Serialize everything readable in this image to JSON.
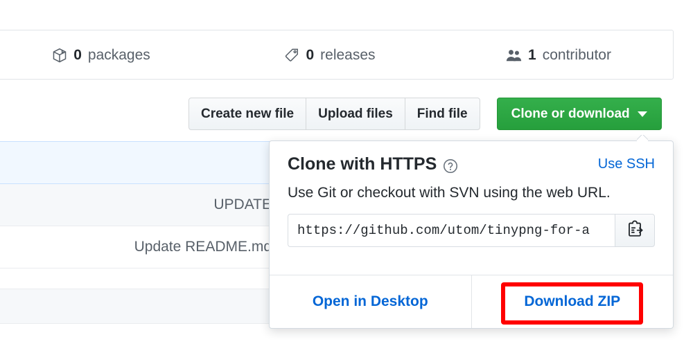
{
  "stats_bar": {
    "items": [
      {
        "icon": "package-icon",
        "count": "0",
        "label": "packages"
      },
      {
        "icon": "tag-icon",
        "count": "0",
        "label": "releases"
      },
      {
        "icon": "people-icon",
        "count": "1",
        "label": "contributor"
      }
    ]
  },
  "file_toolbar": {
    "create_new_file": "Create new file",
    "upload_files": "Upload files",
    "find_file": "Find file",
    "clone_or_download": "Clone or download"
  },
  "file_list": {
    "rows": [
      {
        "text": ""
      },
      {
        "text": "UPDATE"
      },
      {
        "text": "Update README.md"
      },
      {
        "text": ""
      },
      {
        "text": ""
      },
      {
        "text": ""
      }
    ]
  },
  "clone_dropdown": {
    "title": "Clone with HTTPS",
    "help_icon": "question-circle-icon",
    "use_ssh": "Use SSH",
    "description": "Use Git or checkout with SVN using the web URL.",
    "url_value": "https://github.com/utom/tinypng-for-a",
    "url_placeholder": "https://github.com/",
    "copy_icon": "clipboard-copy-icon",
    "open_in_desktop": "Open in Desktop",
    "download_zip": "Download ZIP"
  },
  "annotation": {
    "highlight_color": "#ff0000",
    "highlight_target": "Download ZIP"
  },
  "colors": {
    "green_button": "#28a745",
    "link_blue": "#0366d6",
    "text_dark": "#24292e",
    "text_muted": "#586069",
    "border": "#e1e4e8",
    "row_highlight": "#f1f8ff"
  }
}
